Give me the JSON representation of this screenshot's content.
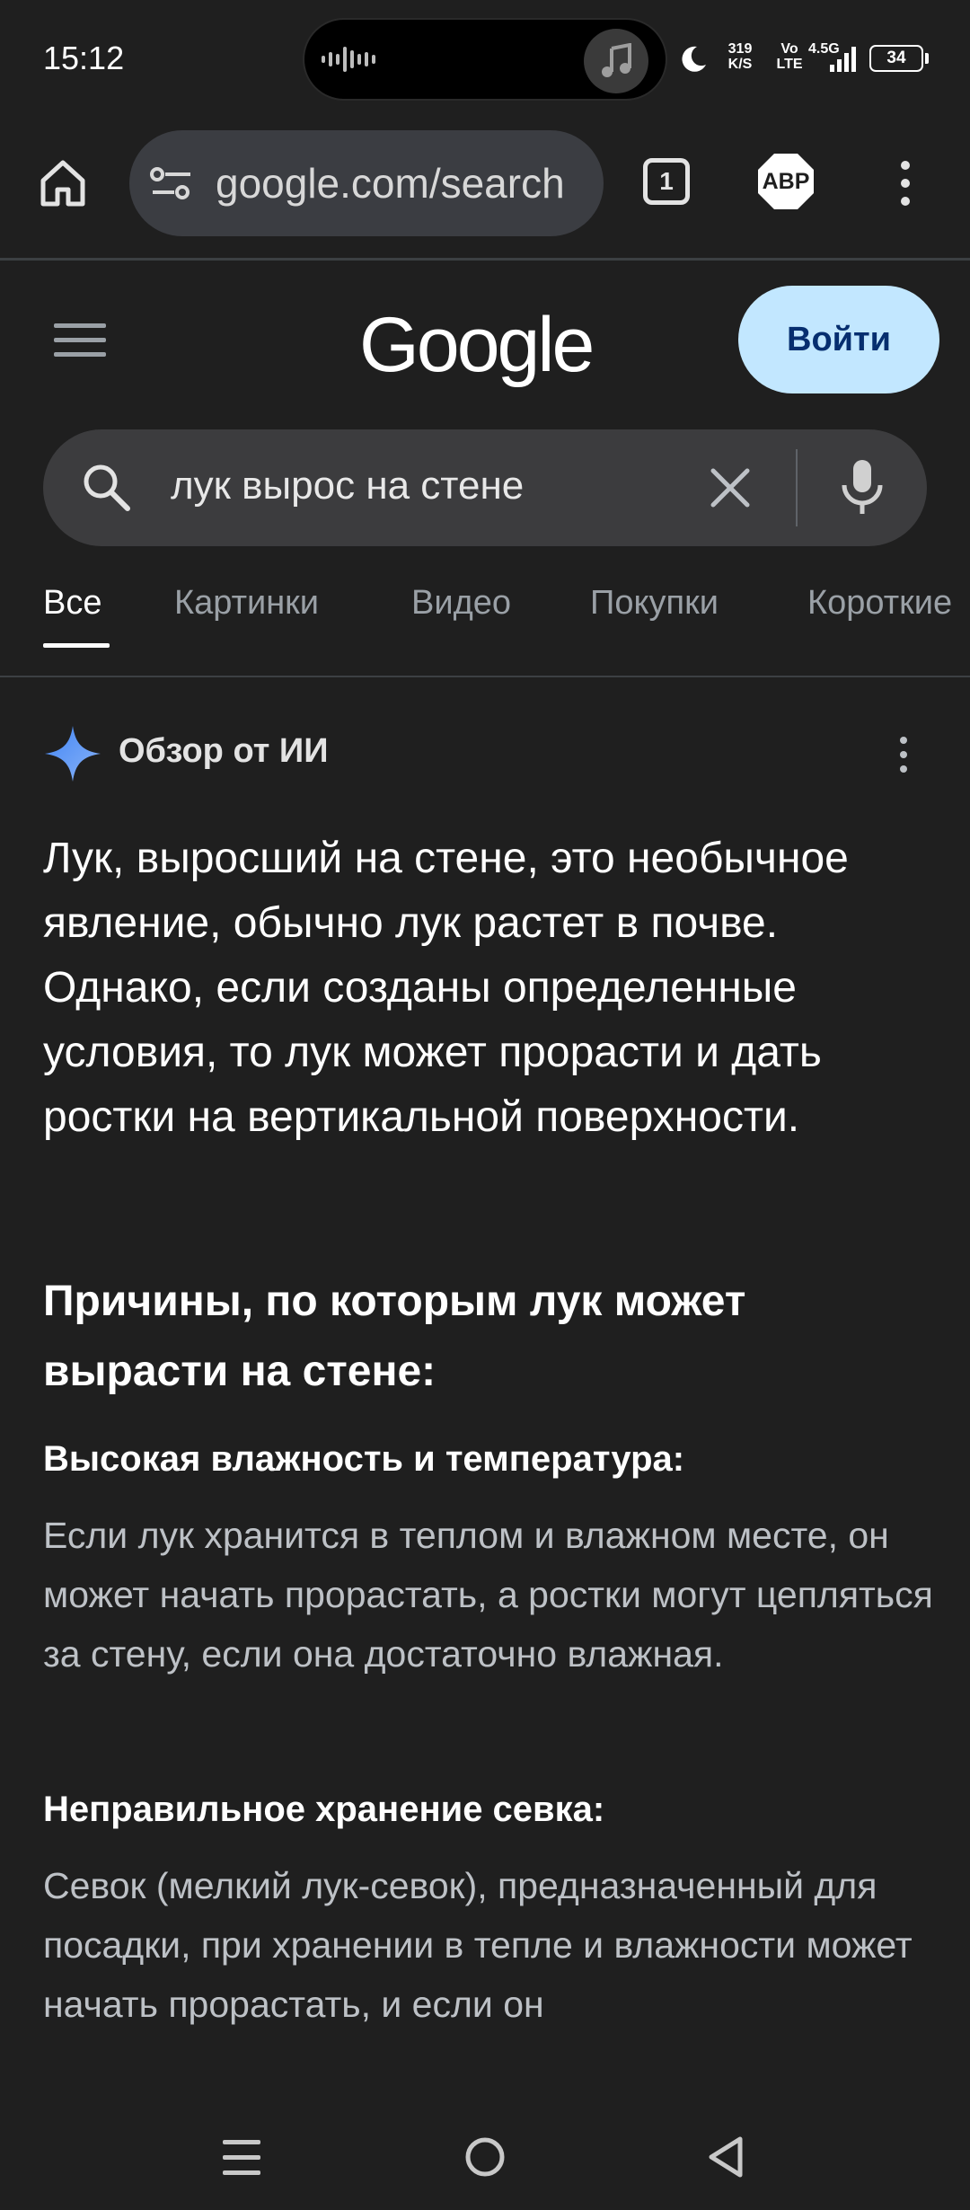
{
  "status_bar": {
    "time": "15:12",
    "speed_value": "319",
    "speed_unit": "K/S",
    "volte_top": "Vo",
    "volte_bottom": "LTE",
    "network": "4.5G",
    "battery": "34"
  },
  "browser": {
    "url": "google.com/search",
    "tab_count": "1",
    "adblock_label": "ABP"
  },
  "header": {
    "logo": "Google",
    "signin_label": "Войти"
  },
  "search": {
    "query": "лук вырос на стене"
  },
  "tabs": [
    {
      "label": "Все"
    },
    {
      "label": "Картинки"
    },
    {
      "label": "Видео"
    },
    {
      "label": "Покупки"
    },
    {
      "label": "Короткие"
    }
  ],
  "ai_overview": {
    "title": "Обзор от ИИ",
    "intro": "Лук, выросший на стене, это необычное явление, обычно лук растет в почве. Однако, если созданы определенные условия, то лук может прорасти и дать ростки на вертикальной поверхности.",
    "heading": "Причины, по которым лук может вырасти на стене:",
    "reasons": [
      {
        "title": "Высокая влажность и температура:",
        "text": "Если лук хранится в теплом и влажном месте, он может начать прорастать, а ростки могут цепляться за стену, если она достаточно влажная."
      },
      {
        "title": "Неправильное хранение севка:",
        "text": "Севок (мелкий лук-севок), предназначенный для посадки, при хранении в тепле и влажности может начать прорастать, и если он"
      }
    ]
  },
  "colors": {
    "background": "#1f1f1f",
    "signin_bg": "#c2e7ff",
    "signin_text": "#062e6f",
    "gemini_blue": "#4285f4"
  }
}
